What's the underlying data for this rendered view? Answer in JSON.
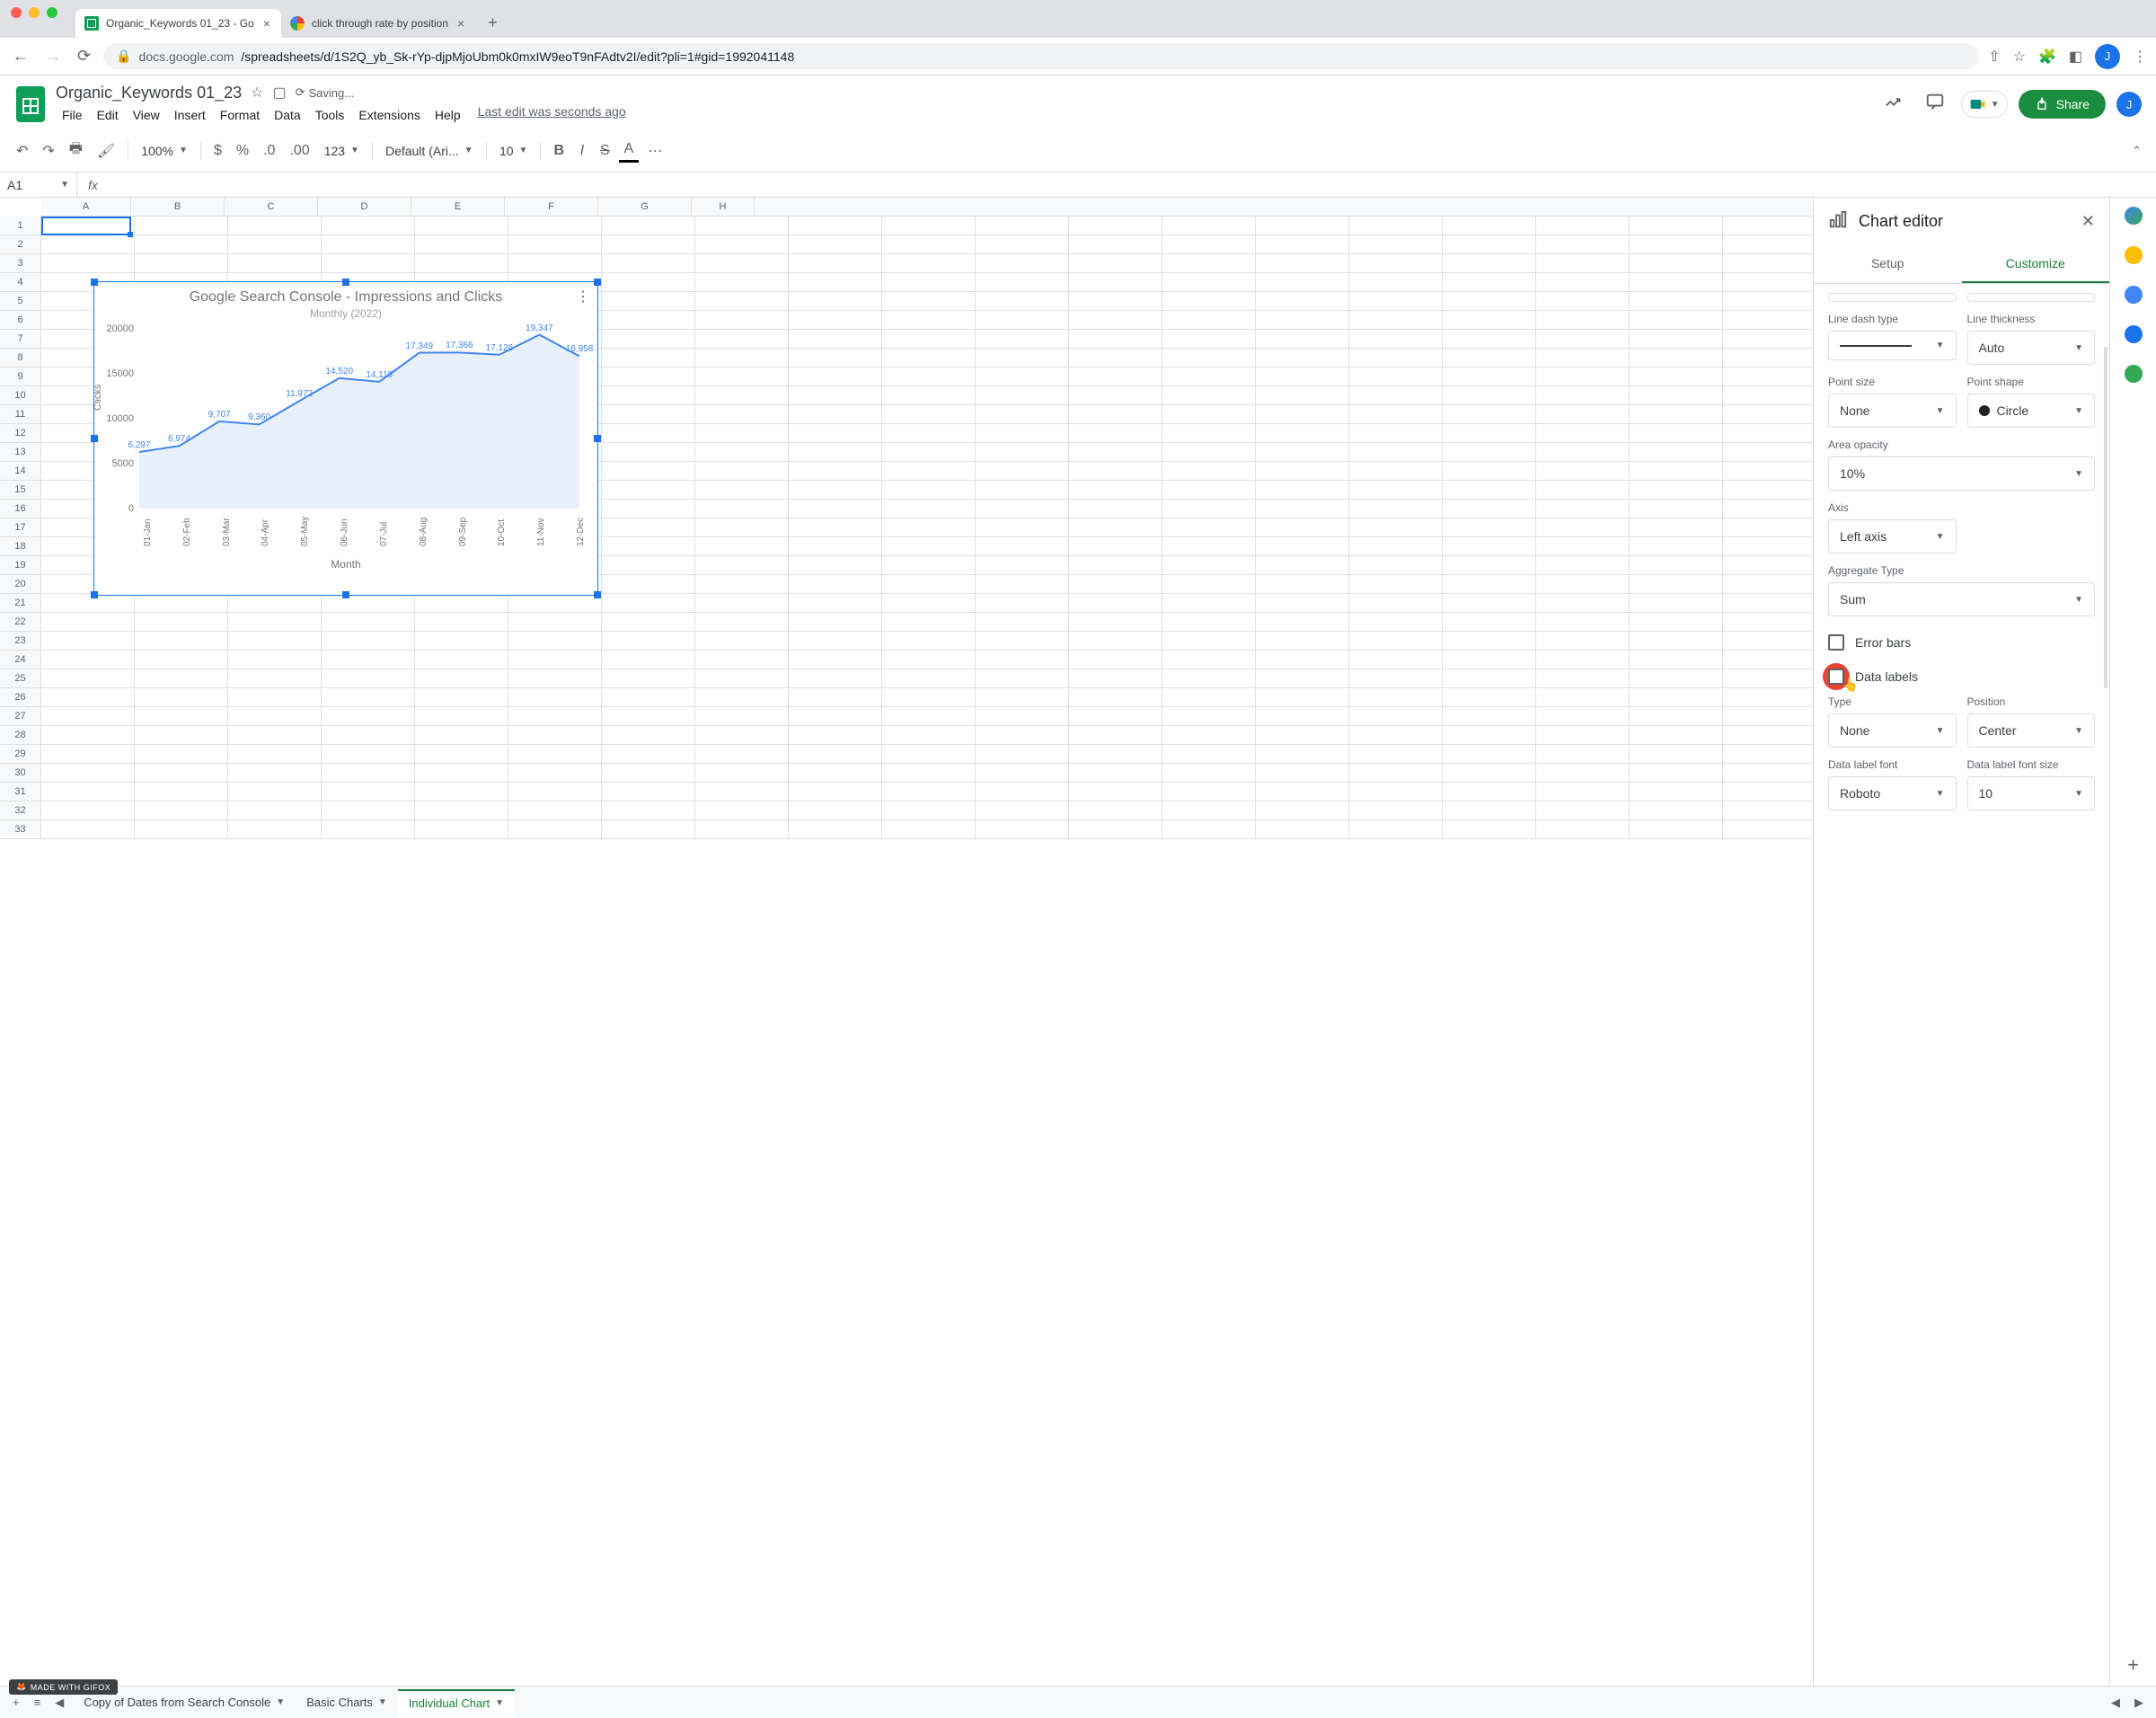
{
  "browser": {
    "tabs": [
      {
        "title": "Organic_Keywords 01_23 - Go",
        "active": true,
        "favicon": "sheets"
      },
      {
        "title": "click through rate by position",
        "active": false,
        "favicon": "google"
      }
    ],
    "url_host": "docs.google.com",
    "url_path": "/spreadsheets/d/1S2Q_yb_Sk-rYp-djpMjoUbm0k0mxIW9eoT9nFAdtv2I/edit?pli=1#gid=1992041148",
    "avatar_letter": "J"
  },
  "doc": {
    "title": "Organic_Keywords 01_23",
    "saving_text": "Saving...",
    "last_edit": "Last edit was seconds ago",
    "menu": [
      "File",
      "Edit",
      "View",
      "Insert",
      "Format",
      "Data",
      "Tools",
      "Extensions",
      "Help"
    ],
    "share_label": "Share"
  },
  "toolbar": {
    "zoom": "100%",
    "format_btns": [
      "$",
      "%",
      ".0",
      ".00",
      "123"
    ],
    "font": "Default (Ari...",
    "font_size": "10"
  },
  "fxbar": {
    "cell_ref": "A1"
  },
  "grid": {
    "cols": [
      "A",
      "B",
      "C",
      "D",
      "E",
      "F",
      "G",
      "H"
    ],
    "row_count": 33
  },
  "chart_data": {
    "type": "area",
    "title": "Google Search Console - Impressions and Clicks",
    "subtitle": "Monthly (2022)",
    "xlabel": "Month",
    "ylabel": "Clicks",
    "ylim": [
      0,
      20000
    ],
    "yticks": [
      0,
      5000,
      10000,
      15000,
      20000
    ],
    "categories": [
      "01-Jan",
      "02-Feb",
      "03-Mar",
      "04-Apr",
      "05-May",
      "06-Jun",
      "07-Jul",
      "08-Aug",
      "09-Sep",
      "10-Oct",
      "11-Nov",
      "12-Dec"
    ],
    "values": [
      6297,
      6974,
      9707,
      9360,
      11972,
      14520,
      14119,
      17349,
      17366,
      17126,
      19347,
      16958
    ]
  },
  "sidebar": {
    "title": "Chart editor",
    "tabs": {
      "setup": "Setup",
      "customize": "Customize"
    },
    "fields": {
      "line_dash_type": "Line dash type",
      "line_thickness_label": "Line thickness",
      "line_thickness_value": "Auto",
      "point_size_label": "Point size",
      "point_size_value": "None",
      "point_shape_label": "Point shape",
      "point_shape_value": "Circle",
      "area_opacity_label": "Area opacity",
      "area_opacity_value": "10%",
      "axis_label": "Axis",
      "axis_value": "Left axis",
      "aggregate_label": "Aggregate Type",
      "aggregate_value": "Sum",
      "error_bars": "Error bars",
      "data_labels": "Data labels",
      "type_label": "Type",
      "type_value": "None",
      "position_label": "Position",
      "position_value": "Center",
      "dl_font_label": "Data label font",
      "dl_font_value": "Roboto",
      "dl_fontsize_label": "Data label font size",
      "dl_fontsize_value": "10"
    }
  },
  "sheet_tabs": {
    "tabs": [
      "Copy of Dates from Search Console",
      "Basic Charts",
      "Individual Chart"
    ],
    "active": 2
  },
  "gifox": "MADE WITH GIFOX"
}
